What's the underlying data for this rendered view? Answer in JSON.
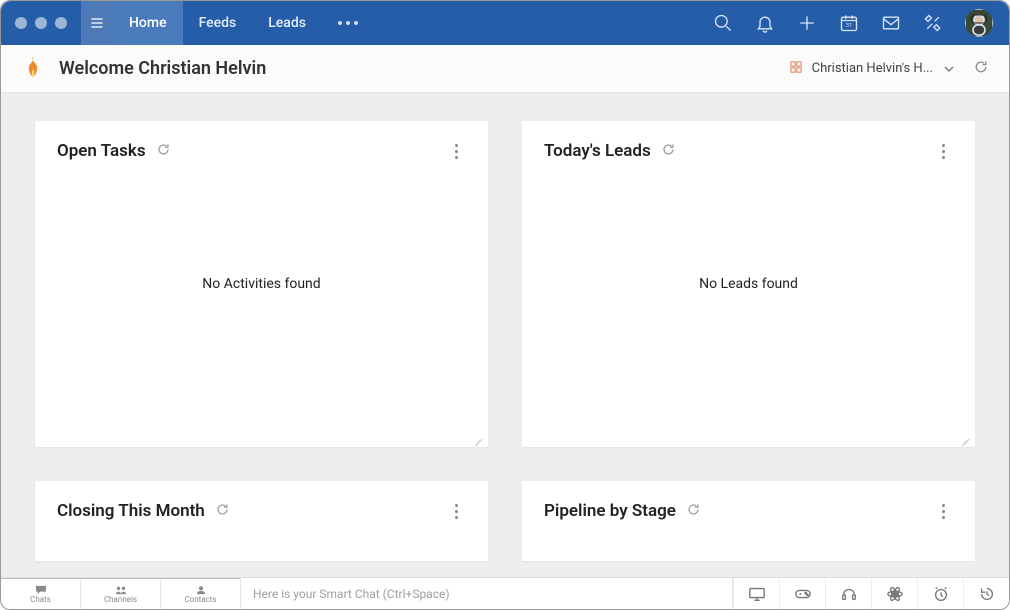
{
  "nav": {
    "items": [
      {
        "label": "Home",
        "active": true
      },
      {
        "label": "Feeds",
        "active": false
      },
      {
        "label": "Leads",
        "active": false
      }
    ]
  },
  "calendar_day": "31",
  "subheader": {
    "welcome": "Welcome Christian Helvin",
    "account_name": "Christian Helvin's H..."
  },
  "cards": {
    "open_tasks": {
      "title": "Open Tasks",
      "empty": "No Activities found"
    },
    "todays_leads": {
      "title": "Today's Leads",
      "empty": "No Leads found"
    },
    "closing_month": {
      "title": "Closing This Month"
    },
    "pipeline": {
      "title": "Pipeline by Stage"
    }
  },
  "footer": {
    "tabs": [
      {
        "label": "Chats"
      },
      {
        "label": "Channels"
      },
      {
        "label": "Contacts"
      }
    ],
    "smart_chat_placeholder": "Here is your Smart Chat (Ctrl+Space)"
  }
}
